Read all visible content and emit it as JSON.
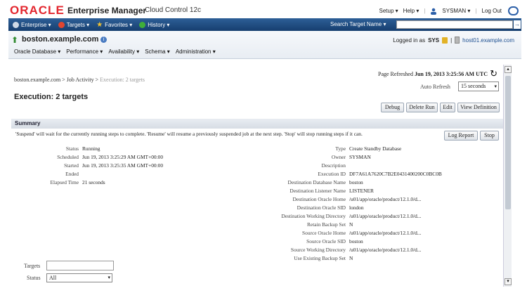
{
  "branding": {
    "logo": "ORACLE",
    "product": "Enterprise Manager",
    "edition": "Cloud Control 12c",
    "setup": "Setup ▾",
    "help": "Help ▾",
    "user": "SYSMAN ▾",
    "logout": "Log Out"
  },
  "global_nav": {
    "enterprise": "Enterprise ▾",
    "targets": "Targets ▾",
    "favorites": "Favorites ▾",
    "history": "History ▾",
    "search_label": "Search Target Name ▾",
    "search_value": "",
    "go": "→"
  },
  "target": {
    "name": "boston.example.com",
    "menus": [
      "Oracle Database ▾",
      "Performance ▾",
      "Availability ▾",
      "Schema ▾",
      "Administration ▾"
    ],
    "logged_in_as": "Logged in as",
    "user": "SYS",
    "host": "host01.example.com"
  },
  "breadcrumb": {
    "home": "boston.example.com",
    "sep1": ">",
    "jobs": "Job Activity",
    "sep2": ">",
    "current": "Execution: 2 targets"
  },
  "page": {
    "title": "Execution: 2 targets",
    "refreshed_label": "Page Refreshed",
    "refreshed_value": "Jun 19, 2013 3:25:56 AM UTC",
    "auto_refresh_label": "Auto Refresh",
    "auto_refresh_value": "15 seconds"
  },
  "buttons": {
    "debug": "Debug",
    "delete_run": "Delete Run",
    "edit": "Edit",
    "view_definition": "View Definition",
    "log_report": "Log Report",
    "stop": "Stop"
  },
  "summary": {
    "header": "Summary",
    "note": "'Suspend' will wait for the currently running steps to complete. 'Resume' will resume a previously suspended job at the next step. 'Stop' will stop running steps if it can."
  },
  "left_fields": [
    {
      "key": "Status",
      "value": "Running"
    },
    {
      "key": "Scheduled",
      "value": "Jun 19, 2013 3:25:29 AM GMT+00:00"
    },
    {
      "key": "Started",
      "value": "Jun 19, 2013 3:25:35 AM GMT+00:00"
    },
    {
      "key": "Ended",
      "value": ""
    },
    {
      "key": "Elapsed Time",
      "value": "21 seconds"
    }
  ],
  "right_fields": [
    {
      "key": "Type",
      "value": "Create Standby Database"
    },
    {
      "key": "Owner",
      "value": "SYSMAN"
    },
    {
      "key": "Description",
      "value": ""
    },
    {
      "key": "Execution ID",
      "value": "DF7A61A7620C7B2E0431400200C0BC0B"
    },
    {
      "key": "Destination Database Name",
      "value": "boston"
    },
    {
      "key": "Destination Listener Name",
      "value": "LISTENER"
    },
    {
      "key": "Destination Oracle Home",
      "value": "/u01/app/oracle/product/12.1.0/d..."
    },
    {
      "key": "Destination Oracle SID",
      "value": "london"
    },
    {
      "key": "Destination Working Directory",
      "value": "/u01/app/oracle/product/12.1.0/d..."
    },
    {
      "key": "Retain Backup Set",
      "value": "N"
    },
    {
      "key": "Source Oracle Home",
      "value": "/u01/app/oracle/product/12.1.0/d..."
    },
    {
      "key": "Source Oracle SID",
      "value": "boston"
    },
    {
      "key": "Source Working Directory",
      "value": "/u01/app/oracle/product/12.1.0/d..."
    },
    {
      "key": "Use Existing Backup Set",
      "value": "N"
    }
  ],
  "filters": {
    "targets_label": "Targets",
    "targets_value": "",
    "status_label": "Status",
    "status_value": "All"
  }
}
